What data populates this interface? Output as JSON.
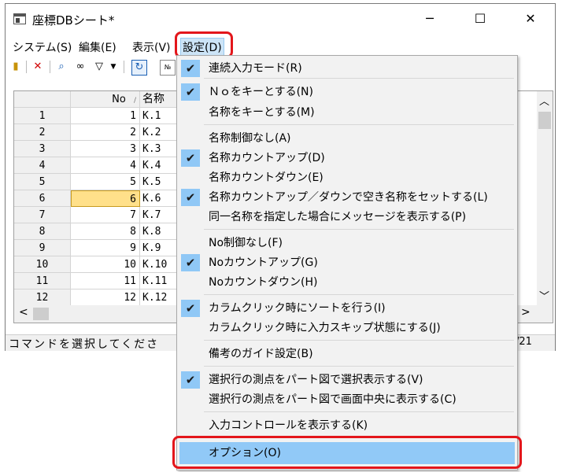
{
  "window": {
    "title": "座標DBシート*",
    "controls": {
      "minimize": "─",
      "maximize": "☐",
      "close": "✕"
    }
  },
  "menubar": {
    "items": [
      {
        "label": "システム(S)"
      },
      {
        "label": "編集(E)"
      },
      {
        "label": "表示(V)"
      },
      {
        "label": "設定(D)"
      }
    ]
  },
  "grid": {
    "columns": {
      "no": "No",
      "sort_indicator": "/",
      "name": "名称"
    },
    "rows": [
      {
        "row": "1",
        "no": "1",
        "name": "K.1"
      },
      {
        "row": "2",
        "no": "2",
        "name": "K.2"
      },
      {
        "row": "3",
        "no": "3",
        "name": "K.3"
      },
      {
        "row": "4",
        "no": "4",
        "name": "K.4"
      },
      {
        "row": "5",
        "no": "5",
        "name": "K.5"
      },
      {
        "row": "6",
        "no": "6",
        "name": "K.6"
      },
      {
        "row": "7",
        "no": "7",
        "name": "K.7"
      },
      {
        "row": "8",
        "no": "8",
        "name": "K.8"
      },
      {
        "row": "9",
        "no": "9",
        "name": "K.9"
      },
      {
        "row": "10",
        "no": "10",
        "name": "K.10"
      },
      {
        "row": "11",
        "no": "11",
        "name": "K.11"
      },
      {
        "row": "12",
        "no": "12",
        "name": "K.12"
      }
    ],
    "scroll_up": "︿",
    "scroll_down": "﹀",
    "scroll_left": "<",
    "scroll_right": ">"
  },
  "status": {
    "text": "コマンドを選択してくださ",
    "right_text": "/21"
  },
  "settings_menu": {
    "items": [
      {
        "label": "連続入力モード(R)",
        "checked": true
      },
      {
        "label": "Ｎｏをキーとする(N)",
        "checked": true
      },
      {
        "label": "名称をキーとする(M)",
        "checked": false
      },
      {
        "label": "名称制御なし(A)",
        "checked": false
      },
      {
        "label": "名称カウントアップ(D)",
        "checked": true
      },
      {
        "label": "名称カウントダウン(E)",
        "checked": false
      },
      {
        "label": "名称カウントアップ／ダウンで空き名称をセットする(L)",
        "checked": true
      },
      {
        "label": "同一名称を指定した場合にメッセージを表示する(P)",
        "checked": false
      },
      {
        "label": "No制御なし(F)",
        "checked": false
      },
      {
        "label": "Noカウントアップ(G)",
        "checked": true
      },
      {
        "label": "Noカウントダウン(H)",
        "checked": false
      },
      {
        "label": "カラムクリック時にソートを行う(I)",
        "checked": true
      },
      {
        "label": "カラムクリック時に入力スキップ状態にする(J)",
        "checked": false
      },
      {
        "label": "備考のガイド設定(B)",
        "checked": false
      },
      {
        "label": "選択行の測点をパート図で選択表示する(V)",
        "checked": true
      },
      {
        "label": "選択行の測点をパート図で画面中央に表示する(C)",
        "checked": false
      },
      {
        "label": "入力コントロールを表示する(K)",
        "checked": false
      },
      {
        "label": "オプション(O)",
        "checked": false
      }
    ],
    "check_glyph": "✔"
  },
  "colors": {
    "highlight_box": "#e3161b",
    "menu_hover": "#91c9f7",
    "check_bg": "#90c8f6",
    "selected_cell": "#ffe08a"
  }
}
